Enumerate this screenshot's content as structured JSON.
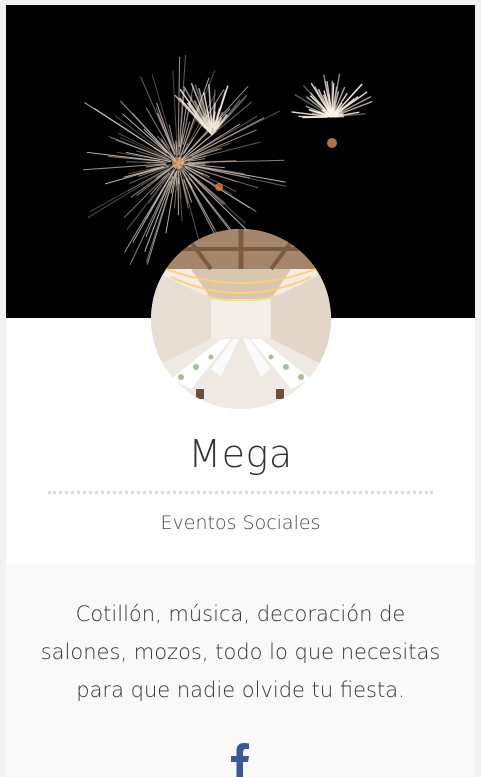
{
  "profile": {
    "name": "Mega",
    "subtitle": "Eventos Sociales",
    "description": "Cotillón, música, decoración de salones, mozos, todo lo que necesitas para que nadie olvide tu fiesta."
  },
  "images": {
    "cover": "fireworks-cover-image",
    "avatar": "banquet-hall-avatar-image"
  },
  "social": {
    "facebook_icon": "facebook-icon",
    "facebook_color": "#3b5998"
  }
}
